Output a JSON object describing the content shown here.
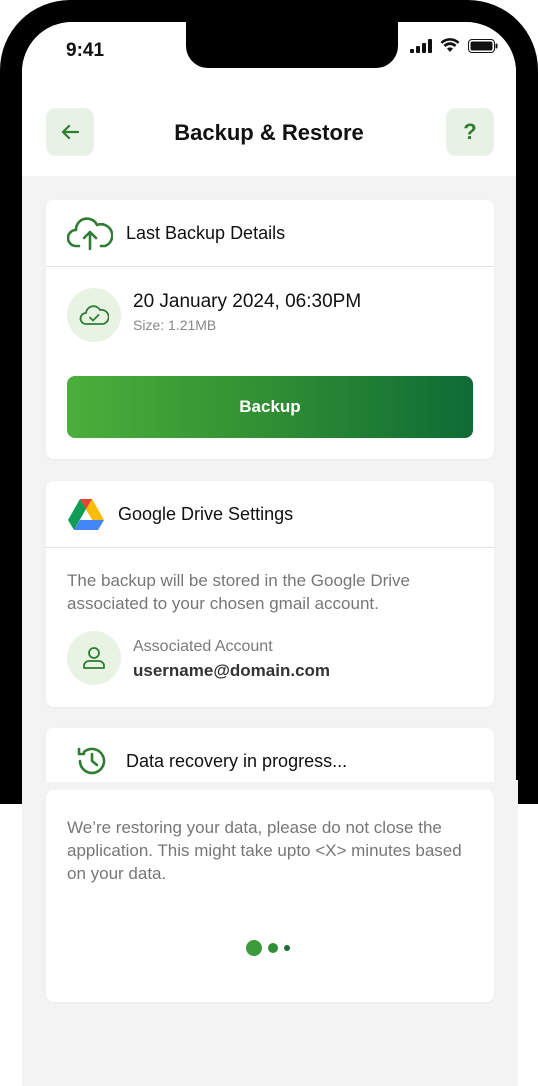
{
  "status_bar": {
    "time": "9:41"
  },
  "header": {
    "title": "Backup & Restore",
    "help_label": "?"
  },
  "last_backup": {
    "title": "Last Backup Details",
    "date": "20 January 2024, 06:30PM",
    "size": "Size: 1.21MB",
    "button_label": "Backup"
  },
  "drive_settings": {
    "title": "Google Drive Settings",
    "description": "The backup will be stored in the Google Drive associated to your chosen gmail account.",
    "account_label": "Associated Account",
    "account_value": "username@domain.com"
  },
  "recovery": {
    "title": "Data recovery in progress...",
    "description": "We’re restoring your data, please do not close the application. This might take upto <X> minutes based on your data."
  },
  "colors": {
    "brand_green": "#2e7d32",
    "accent_light": "#e8f3e4"
  }
}
